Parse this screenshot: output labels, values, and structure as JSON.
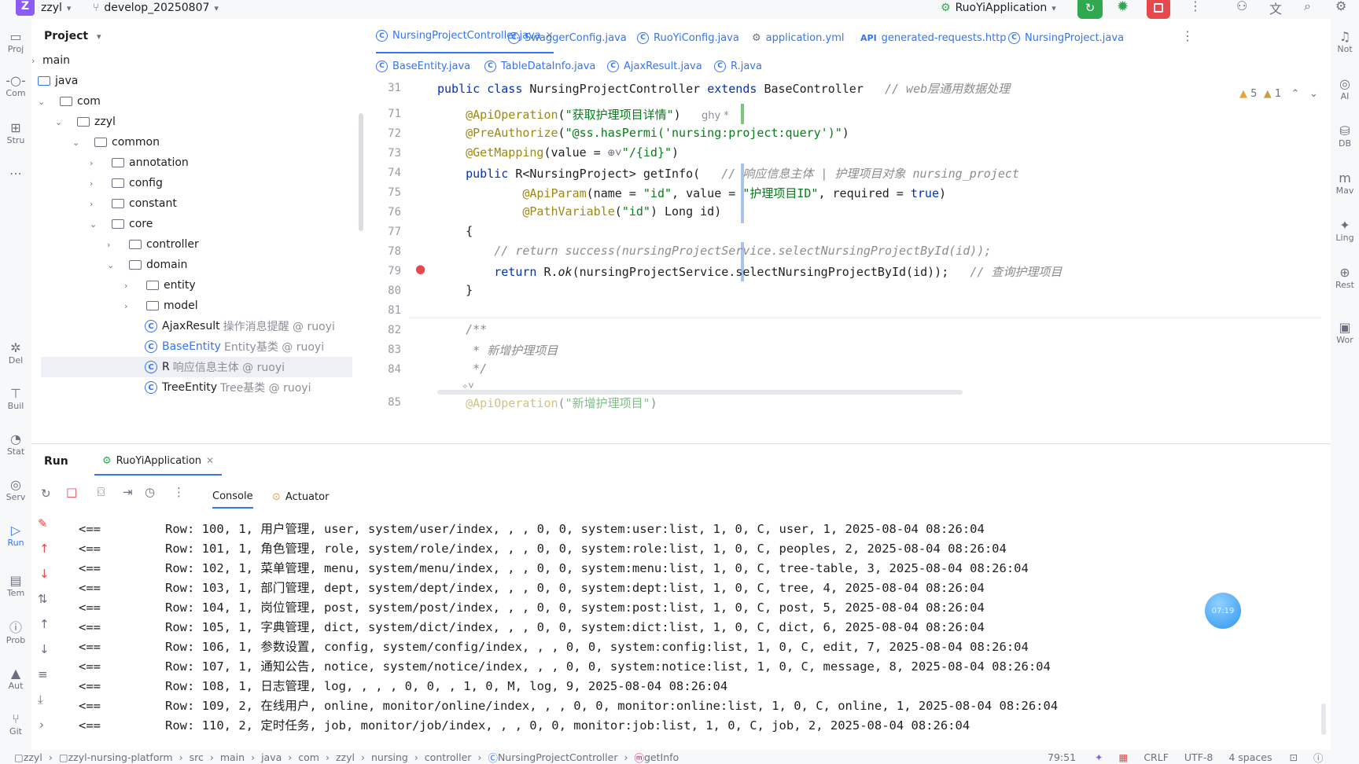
{
  "topbar": {
    "project_badge": "Z",
    "project_name": "zzyl",
    "branch": "develop_20250807",
    "run_config": "RuoYiApplication"
  },
  "leftbar": {
    "items": [
      "Proj",
      "Com",
      "Stru",
      "Del",
      "Buil",
      "Stat",
      "Serv",
      "Run",
      "Tem",
      "Prob",
      "Aut",
      "Git"
    ]
  },
  "rightbar": {
    "items": [
      "Not",
      "AI",
      "DB",
      "Mav",
      "Ling",
      "Rest",
      "Wor"
    ]
  },
  "project": {
    "title": "Project",
    "tree": [
      {
        "label": "main",
        "extra": ""
      },
      {
        "label": "java",
        "extra": ""
      },
      {
        "label": "com",
        "extra": ""
      },
      {
        "label": "zzyl",
        "extra": ""
      },
      {
        "label": "common",
        "extra": ""
      },
      {
        "label": "annotation",
        "extra": ""
      },
      {
        "label": "config",
        "extra": ""
      },
      {
        "label": "constant",
        "extra": ""
      },
      {
        "label": "core",
        "extra": ""
      },
      {
        "label": "controller",
        "extra": ""
      },
      {
        "label": "domain",
        "extra": ""
      },
      {
        "label": "entity",
        "extra": ""
      },
      {
        "label": "model",
        "extra": ""
      },
      {
        "label": "AjaxResult",
        "extra": "操作消息提醒 @ ruoyi"
      },
      {
        "label": "BaseEntity",
        "extra": "Entity基类 @ ruoyi"
      },
      {
        "label": "R",
        "extra": "响应信息主体 @ ruoyi"
      },
      {
        "label": "TreeEntity",
        "extra": "Tree基类 @ ruoyi"
      }
    ]
  },
  "tabs_row1": [
    {
      "label": "NursingProjectController.java"
    },
    {
      "label": "SwaggerConfig.java"
    },
    {
      "label": "RuoYiConfig.java"
    },
    {
      "label": "application.yml"
    },
    {
      "label": "generated-requests.http"
    },
    {
      "label": "NursingProject.java"
    }
  ],
  "tabs_row2": [
    {
      "label": "BaseEntity.java"
    },
    {
      "label": "TableDataInfo.java"
    },
    {
      "label": "AjaxResult.java"
    },
    {
      "label": "R.java"
    }
  ],
  "editor": {
    "warnings": "5",
    "weak_warnings": "1",
    "lines": [
      {
        "n": "31",
        "text": "public class NursingProjectController extends BaseController   // web层通用数据处理"
      },
      {
        "n": "71",
        "text": "    @ApiOperation(\"获取护理项目详情\")   ghy *"
      },
      {
        "n": "72",
        "text": "    @PreAuthorize(\"@ss.hasPermi('nursing:project:query')\")"
      },
      {
        "n": "73",
        "text": "    @GetMapping(value = \"/{id}\")"
      },
      {
        "n": "74",
        "text": "    public R<NursingProject> getInfo(   // 响应信息主体 | 护理项目对象 nursing_project"
      },
      {
        "n": "75",
        "text": "            @ApiParam(name = \"id\", value = \"护理项目ID\", required = true)"
      },
      {
        "n": "76",
        "text": "            @PathVariable(\"id\") Long id)"
      },
      {
        "n": "77",
        "text": "    {"
      },
      {
        "n": "78",
        "text": "        // return success(nursingProjectService.selectNursingProjectById(id));"
      },
      {
        "n": "79",
        "text": "        return R.ok(nursingProjectService.selectNursingProjectById(id));   // 查询护理项目"
      },
      {
        "n": "80",
        "text": "    }"
      },
      {
        "n": "81",
        "text": ""
      },
      {
        "n": "82",
        "text": "    /**"
      },
      {
        "n": "83",
        "text": "     * 新增护理项目"
      },
      {
        "n": "84",
        "text": "     */"
      },
      {
        "n": "85",
        "text": "    @ApiOperation(\"新增护理项目\")   ghy *"
      }
    ]
  },
  "run": {
    "title": "Run",
    "tab": "RuoYiApplication",
    "subtabs": [
      "Console",
      "Actuator"
    ],
    "lines": [
      {
        "arrow": "<==",
        "text": "Row: 100, 1, 用户管理, user, system/user/index, , , 0, 0, system:user:list, 1, 0, C, user, 1, 2025-08-04 08:26:04"
      },
      {
        "arrow": "<==",
        "text": "Row: 101, 1, 角色管理, role, system/role/index, , , 0, 0, system:role:list, 1, 0, C, peoples, 2, 2025-08-04 08:26:04"
      },
      {
        "arrow": "<==",
        "text": "Row: 102, 1, 菜单管理, menu, system/menu/index, , , 0, 0, system:menu:list, 1, 0, C, tree-table, 3, 2025-08-04 08:26:04"
      },
      {
        "arrow": "<==",
        "text": "Row: 103, 1, 部门管理, dept, system/dept/index, , , 0, 0, system:dept:list, 1, 0, C, tree, 4, 2025-08-04 08:26:04"
      },
      {
        "arrow": "<==",
        "text": "Row: 104, 1, 岗位管理, post, system/post/index, , , 0, 0, system:post:list, 1, 0, C, post, 5, 2025-08-04 08:26:04"
      },
      {
        "arrow": "<==",
        "text": "Row: 105, 1, 字典管理, dict, system/dict/index, , , 0, 0, system:dict:list, 1, 0, C, dict, 6, 2025-08-04 08:26:04"
      },
      {
        "arrow": "<==",
        "text": "Row: 106, 1, 参数设置, config, system/config/index, , , 0, 0, system:config:list, 1, 0, C, edit, 7, 2025-08-04 08:26:04"
      },
      {
        "arrow": "<==",
        "text": "Row: 107, 1, 通知公告, notice, system/notice/index, , , 0, 0, system:notice:list, 1, 0, C, message, 8, 2025-08-04 08:26:04"
      },
      {
        "arrow": "<==",
        "text": "Row: 108, 1, 日志管理, log, , , , 0, 0, , 1, 0, M, log, 9, 2025-08-04 08:26:04"
      },
      {
        "arrow": "<==",
        "text": "Row: 109, 2, 在线用户, online, monitor/online/index, , , 0, 0, monitor:online:list, 1, 0, C, online, 1, 2025-08-04 08:26:04"
      },
      {
        "arrow": "<==",
        "text": "Row: 110, 2, 定时任务, job, monitor/job/index, , , 0, 0, monitor:job:list, 1, 0, C, job, 2, 2025-08-04 08:26:04"
      }
    ]
  },
  "float_badge": "07:19",
  "statusbar": {
    "crumbs": [
      "zzyl",
      "zzyl-nursing-platform",
      "src",
      "main",
      "java",
      "com",
      "zzyl",
      "nursing",
      "controller",
      "NursingProjectController",
      "getInfo"
    ],
    "position": "79:51",
    "line_sep": "CRLF",
    "encoding": "UTF-8",
    "indent": "4 spaces"
  },
  "colors": {
    "accent": "#3574f0",
    "run_green": "#2fa84f",
    "stop_red": "#e5484d",
    "project_badge": "#8b5cf6"
  }
}
